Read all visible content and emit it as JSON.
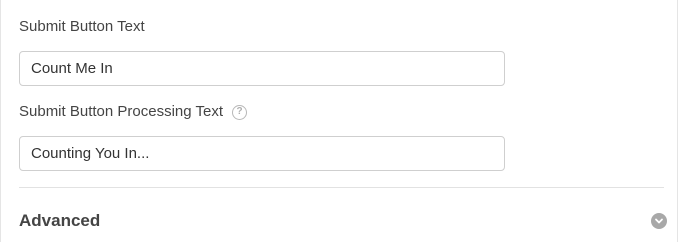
{
  "fields": [
    {
      "label": "Submit Button Text",
      "value": "Count Me In",
      "has_help": false
    },
    {
      "label": "Submit Button Processing Text",
      "value": "Counting You In...",
      "has_help": true,
      "help_icon": "question-circle-icon"
    }
  ],
  "section": {
    "title": "Advanced",
    "toggle_icon": "chevron-down-circle-icon"
  },
  "colors": {
    "label_text": "#444444",
    "input_border": "#cfcfcf",
    "icon_gray": "#a8a8a8"
  }
}
